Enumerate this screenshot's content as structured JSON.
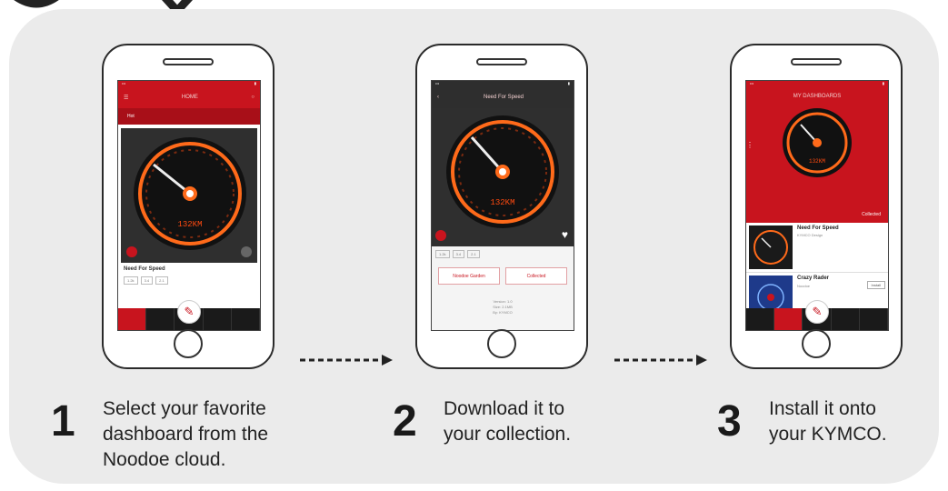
{
  "colors": {
    "panel": "#ebebeb",
    "brand_red": "#c8141e",
    "gauge_orange": "#ff6a1a",
    "dark": "#2e2e2e"
  },
  "phone1": {
    "title": "HOME",
    "tab_active": "Hot",
    "item_name": "Need For Speed",
    "speed_readout": "132KM",
    "chips": [
      "1.2k",
      "3.4",
      "2.1"
    ]
  },
  "phone2": {
    "title": "Need For Speed",
    "speed_readout": "132KM",
    "chips": [
      "1.2k",
      "3.4",
      "2.1"
    ],
    "button_left": "Noodoe Garden",
    "button_right": "Collected",
    "info_lines": [
      "Version: 1.0",
      "Size: 2.1MB",
      "By: KYMCO"
    ]
  },
  "phone3": {
    "title": "MY DASHBOARDS",
    "speed_readout": "132KM",
    "collected_label": "Collected",
    "items": [
      {
        "title": "Need For Speed",
        "subtitle": "KYMCO Design"
      },
      {
        "title": "Crazy Rader",
        "subtitle": "Noodoe",
        "action": "Install"
      }
    ]
  },
  "steps": [
    {
      "number": "1",
      "text": "Select your favorite\ndashboard from the\nNoodoe cloud."
    },
    {
      "number": "2",
      "text": "Download it to\nyour collection."
    },
    {
      "number": "3",
      "text": "Install it onto\nyour KYMCO."
    }
  ],
  "icons": [
    "gauge-icon",
    "edit-fab-icon",
    "heart-icon",
    "arrow-right-icon",
    "home-button-icon"
  ]
}
